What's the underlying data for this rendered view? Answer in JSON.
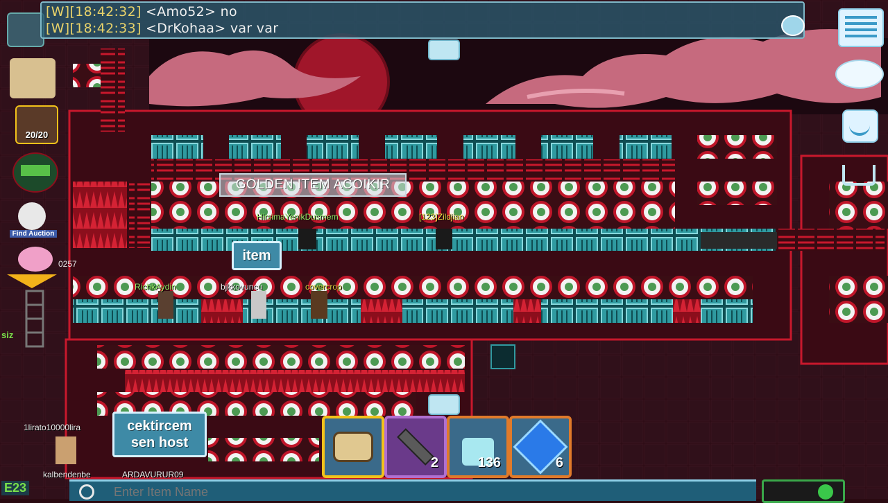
{
  "chat": {
    "lines": [
      {
        "ts": "[W][18:42:32]",
        "name": "<Amo52>",
        "text": "no"
      },
      {
        "ts": "[W][18:42:33]",
        "name": "<DrKohaa>",
        "text": "var var"
      }
    ]
  },
  "signs": {
    "golden_item": "GOLDEN ITEM ACOIKIR",
    "item": "item",
    "cektircem": "cektircem\nsen host"
  },
  "players": {
    "p1": "HirsimaYenikDusmem",
    "p2": "[123]Zildjian",
    "p3": "RichkAydin",
    "p4": "bjkkovuncu",
    "p5": "covercrop",
    "p6": "1lirato10000lira",
    "p7": "kalbendenbe",
    "p8": "ARDAVURUR09"
  },
  "left_panel": {
    "backpack_count": "20/20",
    "find_auction": "Find Auction",
    "piggy_number": "0257",
    "siz": "siz"
  },
  "inventory": [
    {
      "name": "fist",
      "count": ""
    },
    {
      "name": "wrench",
      "count": "2"
    },
    {
      "name": "world-lock",
      "count": "136"
    },
    {
      "name": "blue-gem-lock",
      "count": "6"
    }
  ],
  "bottom": {
    "world_code": "E23",
    "input_placeholder": "Enter Item Name"
  },
  "colors": {
    "bg_sky": "#a0163a",
    "block_red": "#c8182c",
    "block_teal": "#2f9aa0",
    "chat_bg": "#285a6e",
    "highlight_yellow": "#f2c21a"
  }
}
